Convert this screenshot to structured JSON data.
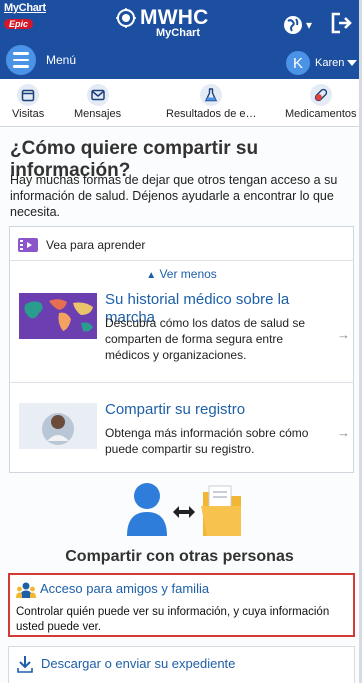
{
  "header": {
    "logo_top": "MyChart",
    "logo_epic": "Epic",
    "brand_name": "MWHC",
    "brand_sub": "MyChart",
    "menu_label": "Menú",
    "user_initial": "K",
    "user_name": "Karen"
  },
  "nav": {
    "items": [
      {
        "label": "Visitas",
        "icon": "calendar-icon"
      },
      {
        "label": "Mensajes",
        "icon": "envelope-icon"
      },
      {
        "label": "Resultados de e…",
        "icon": "flask-icon"
      },
      {
        "label": "Medicamentos",
        "icon": "pill-icon"
      }
    ]
  },
  "main": {
    "title": "¿Cómo quiere compartir su información?",
    "intro": "Hay muchas formas de dejar que otros tengan acceso a su información de salud. Déjenos ayudarle a encontrar lo que necesita.",
    "learn": {
      "header": "Vea para aprender",
      "toggle": "Ver menos",
      "videos": [
        {
          "title": "Su historial médico sobre la marcha",
          "description": "Descubra cómo los datos de salud se comparten de forma segura entre médicos y organizaciones.",
          "thumb": "world-map-thumbnail"
        },
        {
          "title": "Compartir su registro",
          "description": "Obtenga más información sobre cómo puede compartir su registro.",
          "thumb": "person-thumbnail"
        }
      ]
    },
    "share_heading": "Compartir con otras personas",
    "friends": {
      "title": "Acceso para amigos y familia",
      "description": "Controlar quién puede ver su información, y cuya información usted puede ver."
    },
    "download": {
      "label": "Descargar o enviar su expediente"
    }
  },
  "colors": {
    "header_bg": "#1d4fa0",
    "link": "#1d5fa8",
    "highlight_border": "#d13a35",
    "accent_blue": "#4b93e6",
    "folder_yellow": "#f2b632"
  }
}
